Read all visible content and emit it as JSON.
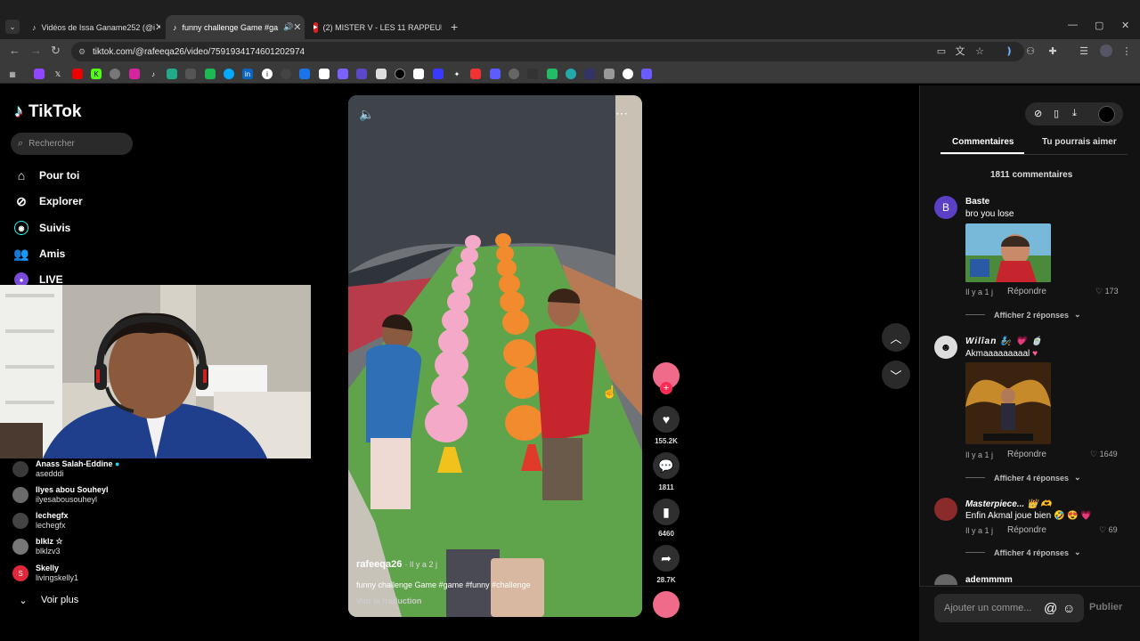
{
  "browser": {
    "tabs": [
      {
        "label": "Vidéos de Issa Ganame252 (@i",
        "icon": "tiktok-icon"
      },
      {
        "label": "funny challenge Game #ga",
        "icon": "tiktok-icon"
      },
      {
        "label": "(2) MISTER V - LES 11 RAPPEUR",
        "icon": "youtube-icon"
      }
    ],
    "url": "tiktok.com/@rafeeqa26/video/7591934174601202974"
  },
  "sidebar": {
    "logo": "TikTok",
    "search_placeholder": "Rechercher",
    "nav": [
      {
        "label": "Pour toi",
        "icon": "home-icon"
      },
      {
        "label": "Explorer",
        "icon": "compass-icon"
      },
      {
        "label": "Suivis",
        "icon": "following-icon"
      },
      {
        "label": "Amis",
        "icon": "friends-icon"
      },
      {
        "label": "LIVE",
        "icon": "live-icon"
      }
    ],
    "following": [
      {
        "name": "Anass Salah-Eddine",
        "handle": "asedddi"
      },
      {
        "name": "Ilyes abou Souheyl",
        "handle": "ilyesabousouheyl"
      },
      {
        "name": "lechegfx",
        "handle": "lechegfx"
      },
      {
        "name": "blklz ☆",
        "handle": "blklzv3"
      },
      {
        "name": "Skelly",
        "handle": "livingskelly1"
      }
    ],
    "see_more": "Voir plus"
  },
  "video": {
    "username": "rafeeqa26",
    "time": "· Il y a 2 j",
    "description": "funny challenge Game #game #funny #challenge",
    "translate": "Voir la traduction",
    "likes": "155.2K",
    "comments": "1811",
    "saves": "6460",
    "shares": "28.7K"
  },
  "panel": {
    "tab_comments": "Commentaires",
    "tab_suggest": "Tu pourrais aimer",
    "count": "1811 commentaires",
    "comments": [
      {
        "name": "Baste",
        "text": "bro you lose",
        "meta": "Il y a 1 j",
        "reply": "Répondre",
        "likes": "173",
        "replies": "Afficher 2 réponses",
        "avatar": "B"
      },
      {
        "name": "Wilîan",
        "text": "Akmaaaaaaaaal",
        "meta": "Il y a 1 j",
        "reply": "Répondre",
        "likes": "1649",
        "replies": "Afficher 4 réponses"
      },
      {
        "name": "Masterpiece...",
        "text": "Enfin Akmal joue bien",
        "meta": "Il y a 1 j",
        "reply": "Répondre",
        "likes": "69",
        "replies": "Afficher 4 réponses"
      },
      {
        "name": "ademmmm"
      }
    ],
    "input_placeholder": "Ajouter un comme...",
    "publish": "Publier"
  }
}
